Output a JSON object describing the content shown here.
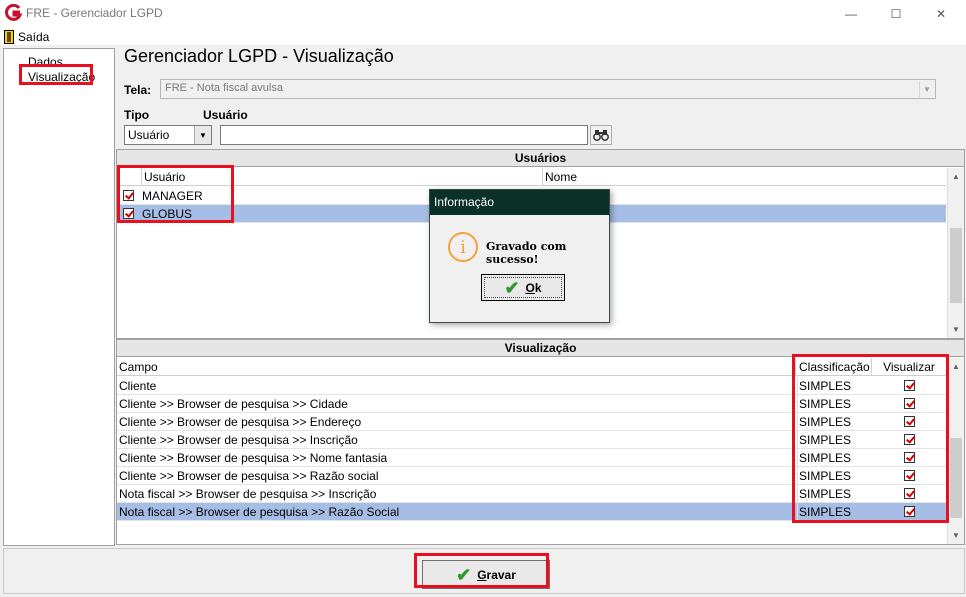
{
  "window": {
    "title": "FRE - Gerenciador LGPD",
    "controls": {
      "minimize": "—",
      "maximize": "☐",
      "close": "✕"
    },
    "app_icon": "fre-logo-icon"
  },
  "menu": {
    "exit_label": "Saída",
    "exit_icon": "door-icon"
  },
  "nav": {
    "items": [
      "Dados",
      "Visualização"
    ],
    "selected": "Visualização"
  },
  "page": {
    "heading": "Gerenciador LGPD - Visualização",
    "tela_label": "Tela:",
    "tela_value": "FRE - Nota fiscal avulsa",
    "tipo_label": "Tipo",
    "usuario_label": "Usuário",
    "tipo_value": "Usuário",
    "usuario_value": ""
  },
  "users_panel": {
    "title": "Usuários",
    "columns": [
      "Usuário",
      "Nome"
    ],
    "rows": [
      {
        "checked": true,
        "usuario": "MANAGER",
        "nome": ""
      },
      {
        "checked": true,
        "usuario": "GLOBUS",
        "nome": "",
        "selected": true
      }
    ]
  },
  "vis_panel": {
    "title": "Visualização",
    "columns": [
      "Campo",
      "Classificação",
      "Visualizar"
    ],
    "rows": [
      {
        "campo": "Cliente",
        "classificacao": "SIMPLES",
        "visualizar": true
      },
      {
        "campo": "Cliente >> Browser de pesquisa >> Cidade",
        "classificacao": "SIMPLES",
        "visualizar": true
      },
      {
        "campo": "Cliente >> Browser de pesquisa >> Endereço",
        "classificacao": "SIMPLES",
        "visualizar": true
      },
      {
        "campo": "Cliente >> Browser de pesquisa >> Inscrição",
        "classificacao": "SIMPLES",
        "visualizar": true
      },
      {
        "campo": "Cliente >> Browser de pesquisa >> Nome fantasia",
        "classificacao": "SIMPLES",
        "visualizar": true
      },
      {
        "campo": "Cliente >> Browser de pesquisa >> Razão social",
        "classificacao": "SIMPLES",
        "visualizar": true
      },
      {
        "campo": "Nota fiscal >> Browser de pesquisa >> Inscrição",
        "classificacao": "SIMPLES",
        "visualizar": true
      },
      {
        "campo": "Nota fiscal >> Browser de pesquisa >> Razão Social",
        "classificacao": "SIMPLES",
        "visualizar": true,
        "selected": true
      }
    ]
  },
  "footer": {
    "save_label_first": "G",
    "save_label_rest": "ravar"
  },
  "dialog": {
    "title": "Informação",
    "message": "Gravado com sucesso!",
    "ok_first": "O",
    "ok_rest": "k",
    "icon": "info-icon"
  },
  "colors": {
    "highlight": "#e8101e",
    "selection": "#a6bde6",
    "dialog_title_bg": "#0b3027",
    "info_icon": "#f2a33a",
    "check_green": "#2e9a2e"
  }
}
